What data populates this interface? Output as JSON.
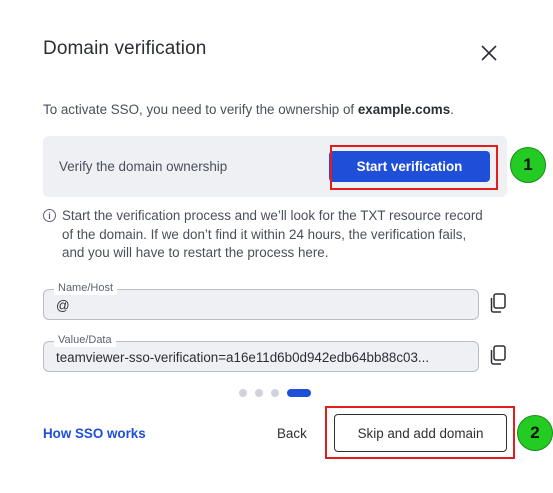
{
  "dialog": {
    "title": "Domain verification",
    "close_icon": "close-icon",
    "intro_prefix": "To activate SSO, you need to verify the ownership of ",
    "intro_domain": "example.coms",
    "intro_suffix": "."
  },
  "verify": {
    "label": "Verify the domain ownership",
    "button_label": "Start verification"
  },
  "info": {
    "icon": "info-icon",
    "icon_glyph": "i",
    "text": "Start the verification process and we’ll look for the TXT resource record of the domain. If we don’t find it within 24 hours, the verification fails, and you will have to restart the process here."
  },
  "fields": {
    "name_legend": "Name/Host",
    "name_value": "@",
    "value_legend": "Value/Data",
    "value_value": "teamviewer-sso-verification=a16e11d6b0d942edb64bb88c03..."
  },
  "copy_icon": "copy-icon",
  "pagination": {
    "total": 4,
    "active": 4
  },
  "footer": {
    "link_label": "How SSO works",
    "back_label": "Back",
    "skip_label": "Skip and add domain"
  },
  "annotations": {
    "badge_1": "1",
    "badge_2": "2"
  },
  "colors": {
    "primary": "#1f4fd8",
    "highlight": "#e31d1d",
    "badge": "#22cc22",
    "panel": "#eef0f4"
  }
}
